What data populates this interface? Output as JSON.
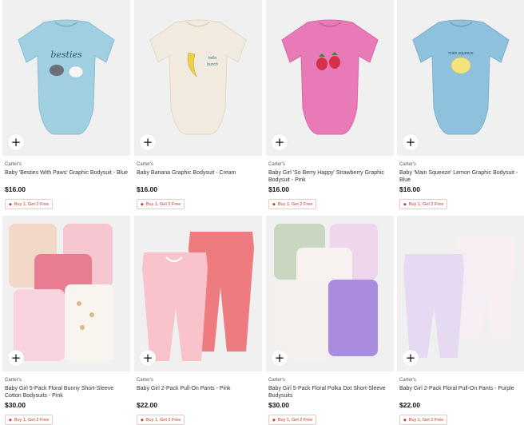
{
  "colors": {
    "promo_text": "#c0392b",
    "image_bg": "#f0f0f0"
  },
  "icons": {
    "add": "plus-icon",
    "promo": "tag-icon"
  },
  "products": [
    {
      "brand": "Carter's",
      "title": "Baby 'Besties With Paws' Graphic Bodysuit - Blue",
      "price": "$16.00",
      "promo": "Buy 1, Get 2 Free",
      "add": "+"
    },
    {
      "brand": "Carter's",
      "title": "Baby Banana Graphic Bodysuit - Cream",
      "price": "$16.00",
      "promo": "Buy 1, Get 2 Free",
      "add": "+"
    },
    {
      "brand": "Carter's",
      "title": "Baby Girl 'So Berry Happy' Strawberry Graphic Bodysuit - Pink",
      "price": "$16.00",
      "promo": "Buy 1, Get 2 Free",
      "add": "+"
    },
    {
      "brand": "Carter's",
      "title": "Baby 'Main Squeeze' Lemon Graphic Bodysuit - Blue",
      "price": "$16.00",
      "promo": "Buy 1, Get 2 Free",
      "add": "+"
    },
    {
      "brand": "Carter's",
      "title": "Baby Girl 5-Pack Floral Bunny Short-Sleeve Cotton Bodysuits - Pink",
      "price": "$30.00",
      "promo": "Buy 1, Get 2 Free",
      "add": "+"
    },
    {
      "brand": "Carter's",
      "title": "Baby Girl 2-Pack Pull-On Pants - Pink",
      "price": "$22.00",
      "promo": "Buy 1, Get 2 Free",
      "add": "+"
    },
    {
      "brand": "Carter's",
      "title": "Baby Girl 5-Pack Floral Polka Dot Short-Sleeve Bodysuits",
      "price": "$30.00",
      "promo": "Buy 1, Get 2 Free",
      "add": "+"
    },
    {
      "brand": "Carter's",
      "title": "Baby Girl 2-Pack Floral Pull-On Pants - Purple",
      "price": "$22.00",
      "promo": "Buy 1, Get 2 Free",
      "add": "+"
    }
  ]
}
